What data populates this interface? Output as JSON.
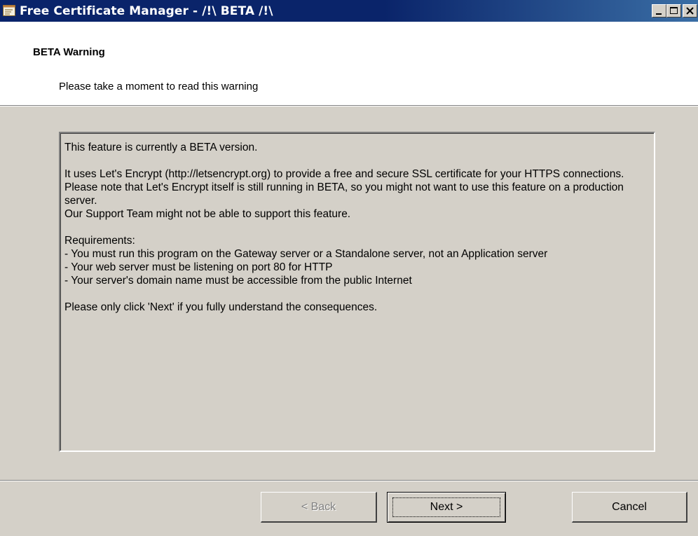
{
  "window": {
    "title": "Free Certificate Manager - /!\\ BETA /!\\",
    "icon": "certificate-app-icon",
    "controls": [
      "minimize-icon",
      "maximize-icon",
      "close-icon"
    ]
  },
  "header": {
    "title": "BETA Warning",
    "subtitle": "Please take a moment to read this warning"
  },
  "warning": {
    "line1": "This feature is currently a BETA version.",
    "para2": "It uses Let's Encrypt (http://letsencrypt.org) to provide a free and secure SSL certificate for your HTTPS connections.",
    "para3": "Please note that Let's Encrypt itself is still running in BETA, so you might not want to use this feature on a production server.",
    "para4": "Our Support Team might not be able to support this feature.",
    "req_title": "Requirements:",
    "req1": "- You must run this program on the Gateway server or a Standalone server, not an Application server",
    "req2": "- Your web server must be listening on port 80 for HTTP",
    "req3": "- Your server's domain name must be accessible from the public Internet",
    "final": "Please only click 'Next' if you fully understand the consequences."
  },
  "buttons": {
    "back": "< Back",
    "next": "Next >",
    "cancel": "Cancel"
  }
}
